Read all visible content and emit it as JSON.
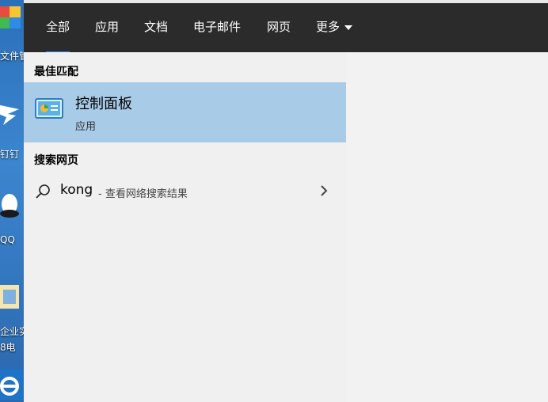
{
  "desktop": {
    "labels": [
      "文件管",
      "钉钉",
      "QQ",
      "企业实",
      "8电"
    ]
  },
  "tabs": [
    {
      "label": "全部",
      "active": true
    },
    {
      "label": "应用"
    },
    {
      "label": "文档"
    },
    {
      "label": "电子邮件"
    },
    {
      "label": "网页"
    },
    {
      "label": "更多"
    }
  ],
  "best_match": {
    "section_title": "最佳匹配",
    "title": "控制面板",
    "subtitle": "应用",
    "icon": "control-panel-icon"
  },
  "web_search": {
    "section_title": "搜索网页",
    "query": "kong",
    "suffix": "- 查看网络搜索结果",
    "icon": "search-icon"
  },
  "colors": {
    "tab_bar": "#2b2b2b",
    "active_underline": "#3b8ae0",
    "selected_row": "#a8cbe8",
    "panel_bg": "#f0f0f0"
  }
}
